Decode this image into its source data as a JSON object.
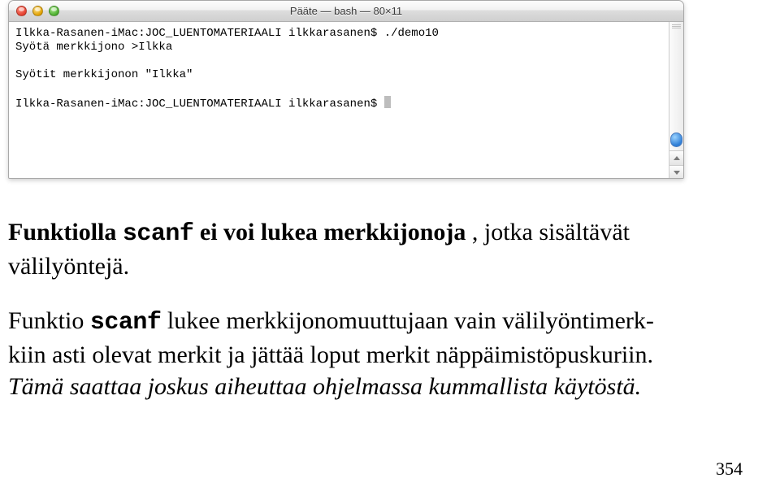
{
  "window": {
    "title": "Pääte — bash — 80×11"
  },
  "terminal": {
    "line1_prompt": "Ilkka-Rasanen-iMac:JOC_LUENTOMATERIAALI ilkkarasanen$ ",
    "line1_cmd": "./demo10",
    "line2": "Syötä merkkijono >Ilkka",
    "blank": " ",
    "line3": "Syötit merkkijonon \"Ilkka\"",
    "line4_prompt": "Ilkka-Rasanen-iMac:JOC_LUENTOMATERIAALI ilkkarasanen$ "
  },
  "text": {
    "p1_a": "Funktiolla ",
    "p1_code": "scanf",
    "p1_b": "  ei voi lukea merkkijonoja ",
    "p1_c": ", jotka sisältävät välilyöntejä.",
    "p2_a": "Funktio ",
    "p2_code": "scanf",
    "p2_b": "  lukee merkkijonomuuttujaan vain välilyöntimerk-",
    "p2_c": "kiin asti olevat merkit ja jättää loput merkit näppäimistöpuskuriin. ",
    "p2_d": "Tämä saattaa joskus aiheuttaa ohjelmassa kummallista käytöstä."
  },
  "page_number": "354"
}
